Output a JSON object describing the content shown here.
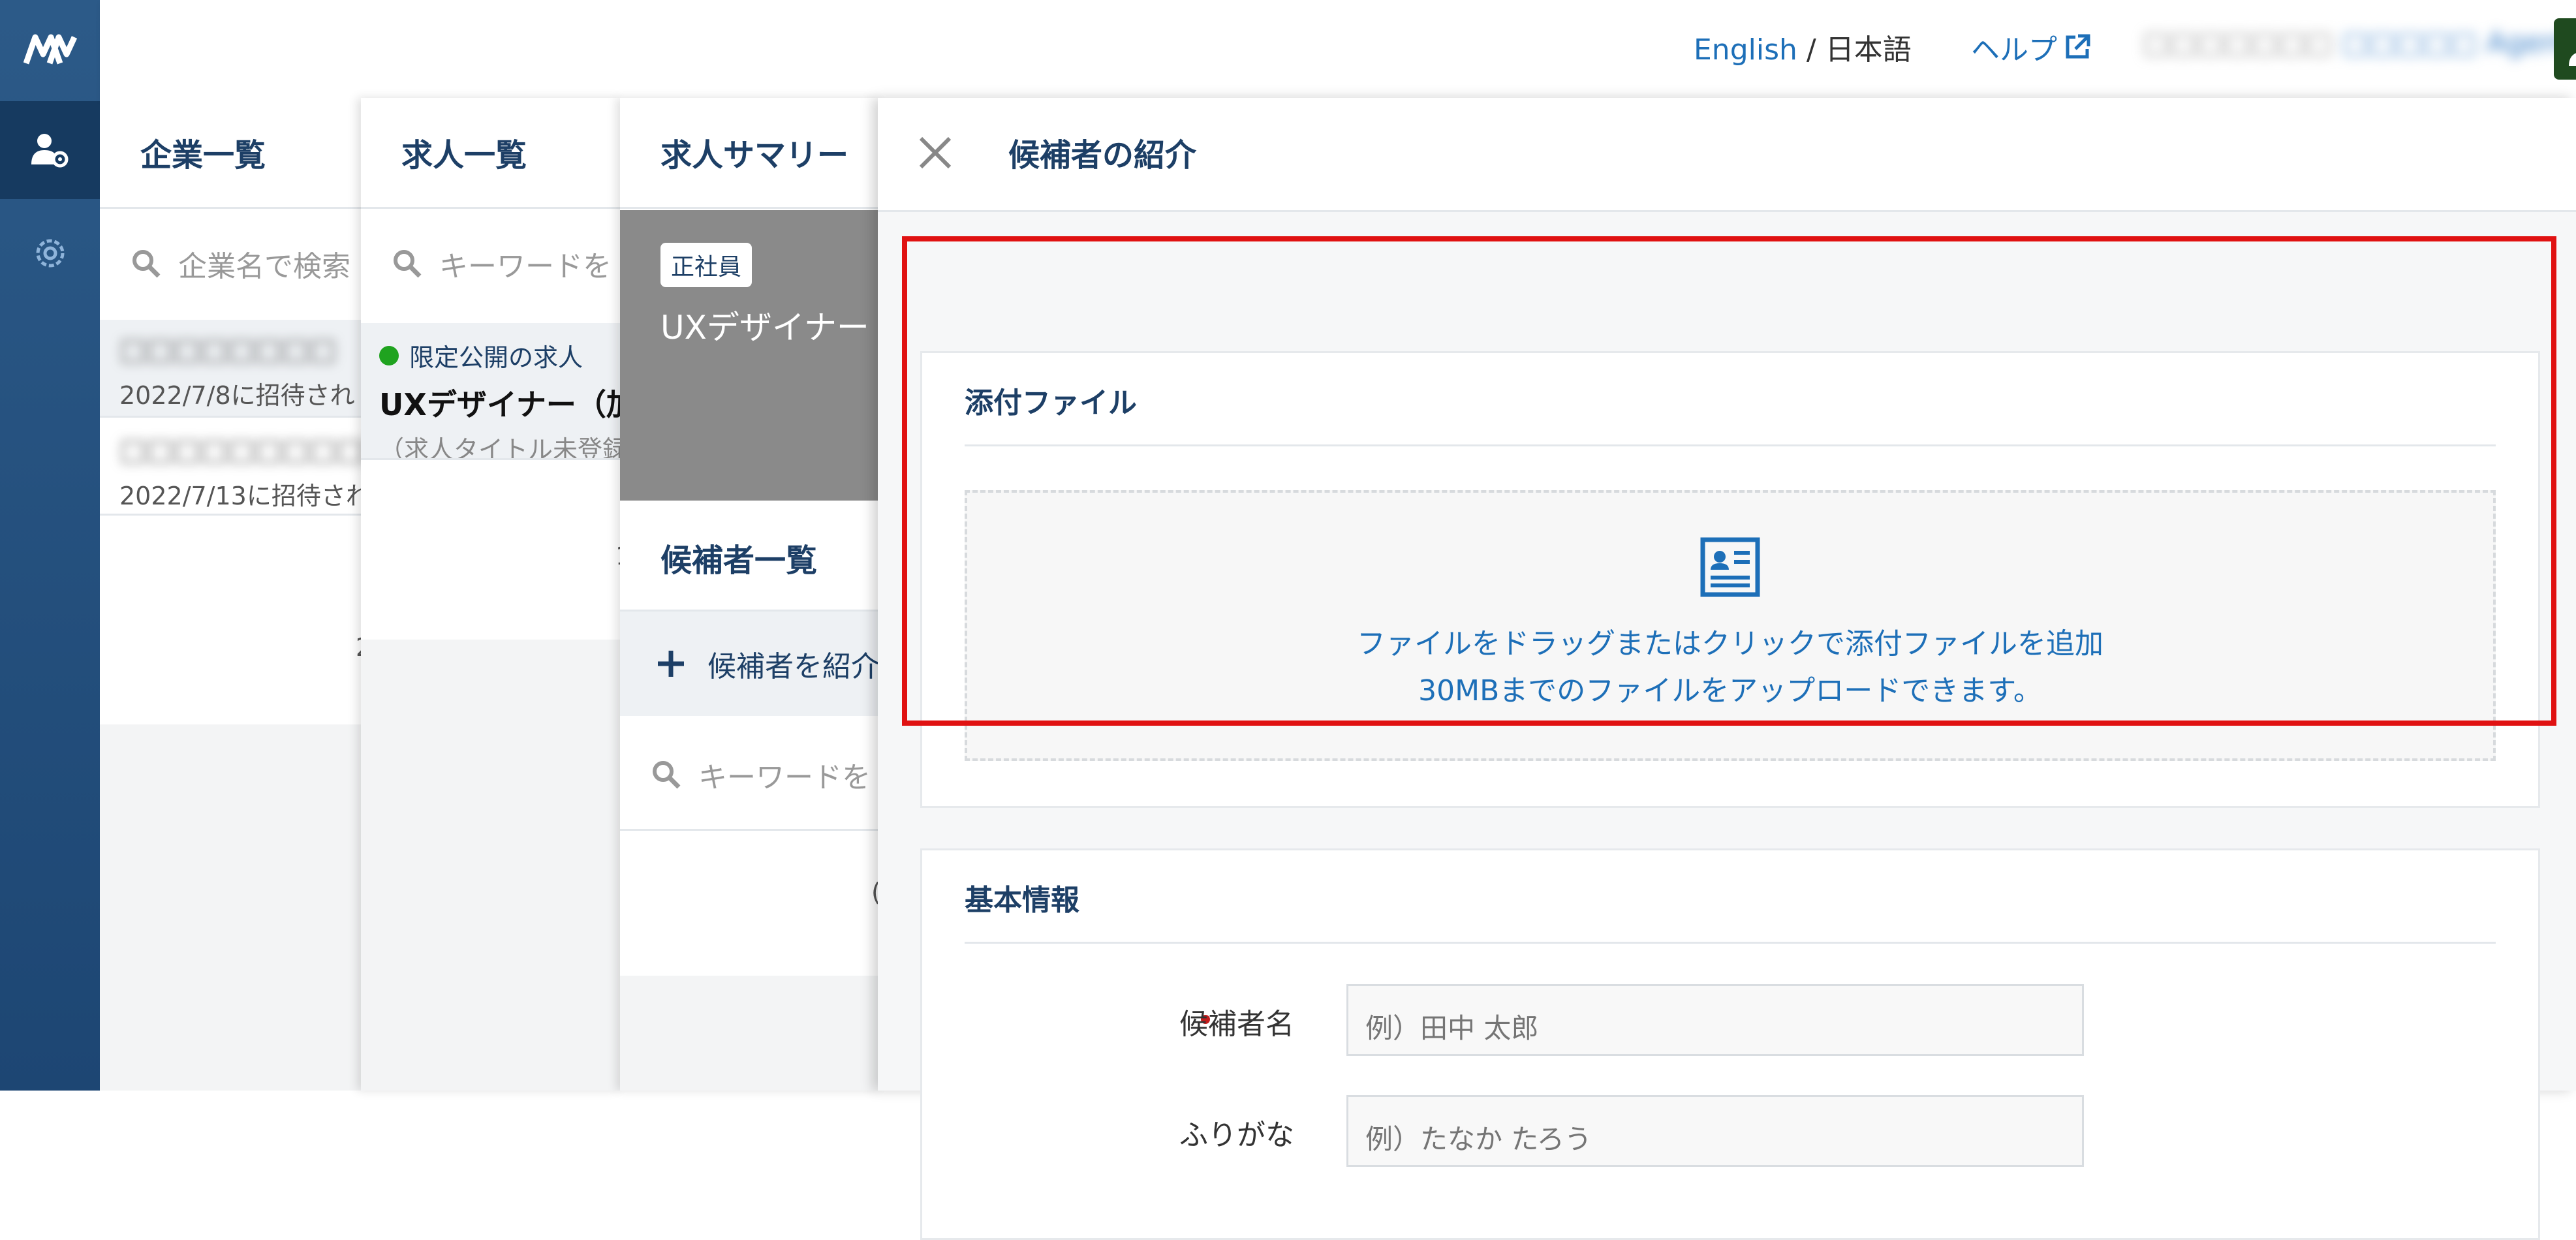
{
  "header": {
    "lang_en": "English",
    "lang_sep": "/",
    "lang_ja": "日本語",
    "help_label": "ヘルプ",
    "org_name": "□□□□□□□",
    "agent_name": "□□□□□ Agent"
  },
  "panels": {
    "companies": {
      "title": "企業一覧",
      "search_placeholder": "企業名で検索",
      "items": [
        {
          "name": "□□□□□□□□",
          "invited": "2022/7/8に招待され"
        },
        {
          "name": "□□□□□□□□□□",
          "invited": "2022/7/13に招待され"
        }
      ],
      "pager": "2"
    },
    "jobs": {
      "title": "求人一覧",
      "search_placeholder": "キーワードを",
      "items": [
        {
          "status": "限定公開の求人",
          "title": "UXデザイナー（加",
          "subtitle": "（求人タイトル未登録"
        }
      ],
      "pager": "1"
    },
    "summary": {
      "title": "求人サマリー",
      "badge": "正社員",
      "job_title": "UXデザイナー",
      "candidates_title": "候補者一覧",
      "add_candidate": "候補者を紹介",
      "search_placeholder": "キーワードを",
      "pager": "("
    }
  },
  "main": {
    "title": "候補者の紹介",
    "attachments": {
      "title": "添付ファイル",
      "drop_line1": "ファイルをドラッグまたはクリックで添付ファイルを追加",
      "drop_line2": "30MBまでのファイルをアップロードできます。"
    },
    "basic_info": {
      "title": "基本情報",
      "fields": [
        {
          "label": "候補者名",
          "placeholder": "例）田中 太郎",
          "required": true
        },
        {
          "label": "ふりがな",
          "placeholder": "例）たなか たろう",
          "required": false
        }
      ]
    }
  },
  "colors": {
    "nav_bg": "#1d4673",
    "accent": "#1d6fb8",
    "title": "#1d3f66",
    "highlight": "#e01212",
    "status_green": "#1fa31f"
  }
}
